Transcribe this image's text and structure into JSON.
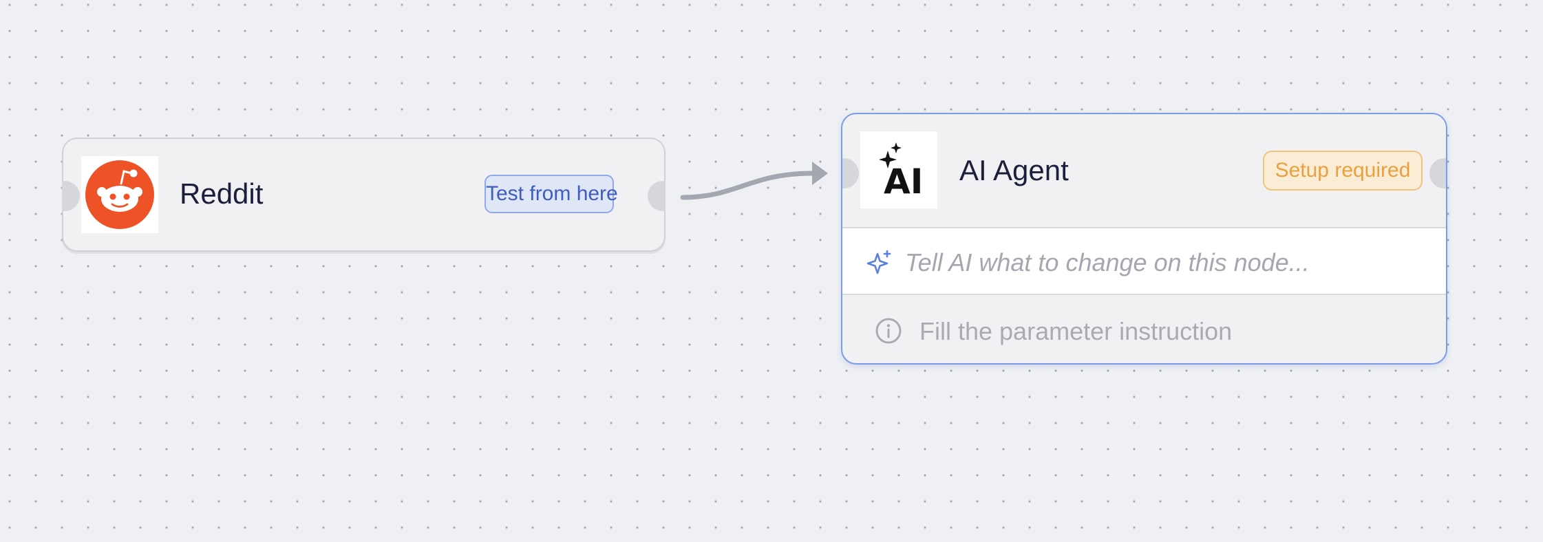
{
  "nodes": {
    "reddit": {
      "title": "Reddit",
      "icon": "reddit-logo-icon",
      "action_label": "Test from here"
    },
    "ai_agent": {
      "title": "AI Agent",
      "icon": "ai-logo-icon",
      "logo_text": "AI",
      "status_badge": "Setup required",
      "prompt_placeholder": "Tell AI what to change on this node...",
      "info_text": "Fill the parameter instruction"
    }
  },
  "colors": {
    "canvas_background": "#eff0f3",
    "reddit_orange": "#ee5327",
    "selected_border": "#7b9ce9",
    "test_button_text": "#3f5cbf",
    "badge_text": "#e9a13e",
    "connector": "#a4a6b0"
  }
}
